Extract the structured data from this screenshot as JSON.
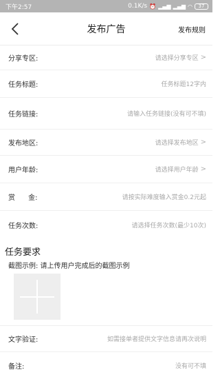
{
  "status_bar": {
    "time": "下午2:57",
    "network_speed": "0.1K/s",
    "battery": "37"
  },
  "navbar": {
    "title": "发布广告",
    "right_action": "发布规则"
  },
  "form": {
    "share_zone": {
      "label": "分享专区:",
      "placeholder": "请选择分享专区"
    },
    "task_title": {
      "label": "任务标题:",
      "placeholder": "任务标题12字内"
    },
    "task_link": {
      "label": "任务链接:",
      "placeholder": "请输入任务链接(没有可不填)"
    },
    "region": {
      "label": "发布地区:",
      "placeholder": "请选择发布地区"
    },
    "user_age": {
      "label": "用户年龄:",
      "placeholder": "请选择用户年龄"
    },
    "reward": {
      "label": "赏      金:",
      "placeholder": "请按实际难度输入赏金0.2元起"
    },
    "task_count": {
      "label": "任务次数:",
      "placeholder": "请选择任务次数(最少10次)"
    }
  },
  "requirements": {
    "section_title": "任务要求",
    "example_label": "截图示例:  请上传用户完成后的截图示例",
    "text_verify": {
      "label": "文字验证:",
      "placeholder": "如需接单者提供文字信息请再次说明"
    },
    "notes": {
      "label": "备注:",
      "placeholder": "没有可不填"
    }
  },
  "icons": {
    "back": "back-arrow-icon",
    "chevron": "chevron-right-icon",
    "plus": "plus-icon",
    "chevron_glyph": ">"
  },
  "colors": {
    "status_bar_bg": "#b4b4b4",
    "placeholder": "#a8a8a8",
    "divider": "#efefef",
    "upload_bg": "#eeeeee"
  }
}
